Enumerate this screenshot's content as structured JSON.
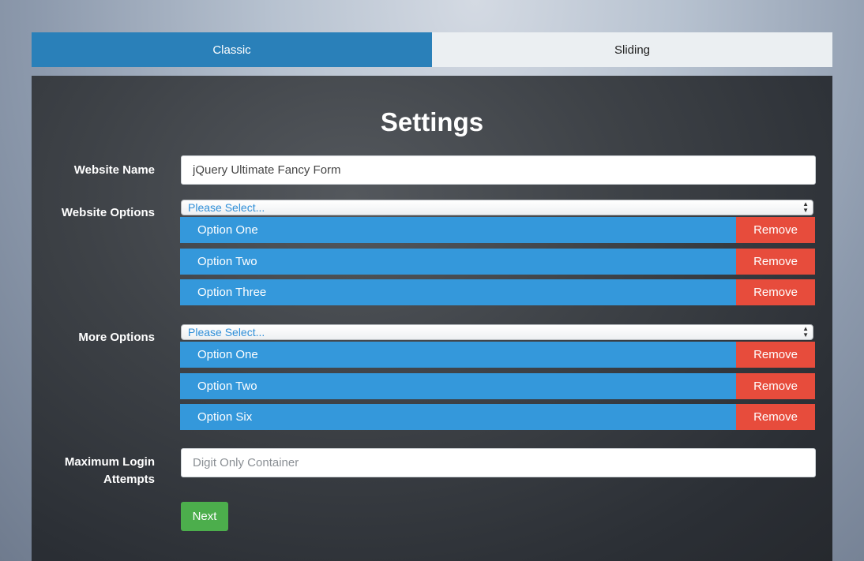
{
  "tabs": [
    {
      "label": "Classic"
    },
    {
      "label": "Sliding"
    }
  ],
  "form": {
    "title": "Settings",
    "website_name": {
      "label": "Website Name",
      "value": "jQuery Ultimate Fancy Form"
    },
    "website_options": {
      "label": "Website Options",
      "select_placeholder": "Please Select...",
      "items": [
        {
          "label": "Option One",
          "remove": "Remove"
        },
        {
          "label": "Option Two",
          "remove": "Remove"
        },
        {
          "label": "Option Three",
          "remove": "Remove"
        }
      ]
    },
    "more_options": {
      "label": "More Options",
      "select_placeholder": "Please Select...",
      "items": [
        {
          "label": "Option One",
          "remove": "Remove"
        },
        {
          "label": "Option Two",
          "remove": "Remove"
        },
        {
          "label": "Option Six",
          "remove": "Remove"
        }
      ]
    },
    "max_login": {
      "label_line1": "Maximum Login",
      "label_line2": "Attempts",
      "placeholder": "Digit Only Container"
    },
    "next_label": "Next"
  },
  "colors": {
    "tab_active": "#2a80b9",
    "option_bg": "#3498db",
    "remove_bg": "#e74c3c",
    "next_bg": "#4cae4c"
  }
}
